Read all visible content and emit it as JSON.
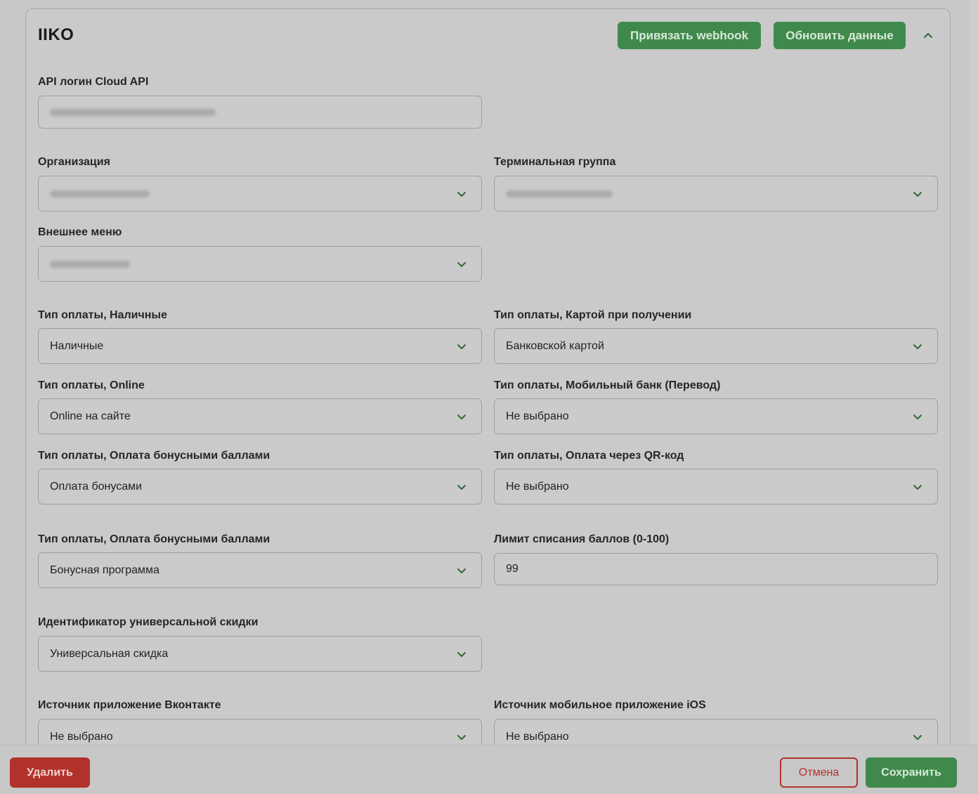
{
  "header": {
    "title": "IIKO",
    "webhook_button": "Привязать webhook",
    "refresh_button": "Обновить данные",
    "collapse_icon": "chevron-up-icon"
  },
  "fields": {
    "api_login": {
      "label": "API логин Cloud API"
    },
    "organization": {
      "label": "Организация"
    },
    "terminal_group": {
      "label": "Терминальная группа"
    },
    "external_menu": {
      "label": "Внешнее меню"
    },
    "pay_cash": {
      "label": "Тип оплаты, Наличные",
      "value": "Наличные"
    },
    "pay_card": {
      "label": "Тип оплаты, Картой при получении",
      "value": "Банковской картой"
    },
    "pay_online": {
      "label": "Тип оплаты, Online",
      "value": "Online на сайте"
    },
    "pay_mobile": {
      "label": "Тип оплаты, Мобильный банк (Перевод)",
      "value": "Не выбрано"
    },
    "pay_bonus": {
      "label": "Тип оплаты, Оплата бонусными баллами",
      "value": "Оплата бонусами"
    },
    "pay_qr": {
      "label": "Тип оплаты, Оплата через QR-код",
      "value": "Не выбрано"
    },
    "bonus_program": {
      "label": "Тип оплаты, Оплата бонусными баллами",
      "value": "Бонусная программа"
    },
    "points_limit": {
      "label": "Лимит списания баллов (0-100)",
      "value": "99"
    },
    "universal_discount": {
      "label": "Идентификатор универсальной скидки",
      "value": "Универсальная скидка"
    },
    "source_vk": {
      "label": "Источник приложение Вконтакте",
      "value": "Не выбрано"
    },
    "source_ios": {
      "label": "Источник мобильное приложение iOS",
      "value": "Не выбрано"
    }
  },
  "footer": {
    "delete_button": "Удалить",
    "cancel_button": "Отмена",
    "save_button": "Сохранить"
  },
  "colors": {
    "primary_green": "#3f8a4b",
    "danger_red": "#b3312b"
  }
}
